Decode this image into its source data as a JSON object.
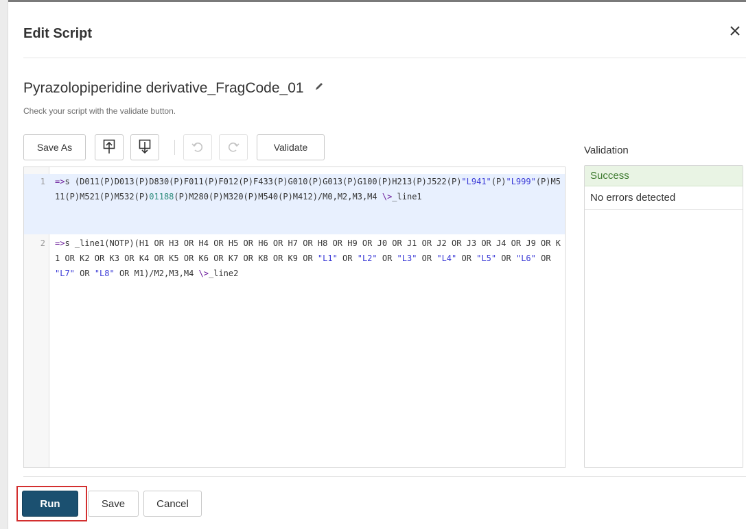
{
  "dialog": {
    "title": "Edit Script",
    "close_icon": "close-icon"
  },
  "script": {
    "name": "Pyrazolopiperidine derivative_FragCode_01",
    "edit_icon": "pencil-icon",
    "hint": "Check your script with the validate button."
  },
  "toolbar": {
    "save_as_label": "Save As",
    "upload_icon": "upload-icon",
    "download_icon": "download-icon",
    "undo_icon": "undo-icon",
    "redo_icon": "redo-icon",
    "validate_label": "Validate"
  },
  "editor": {
    "lines": [
      {
        "number": "1",
        "text": "=>s (D011(P)D013(P)D830(P)F011(P)F012(P)F433(P)G010(P)G013(P)G100(P)H213(P)J522(P)\"L941\"(P)\"L999\"(P)M511(P)M521(P)M532(P)01188(P)M280(P)M320(P)M540(P)M412)/M0,M2,M3,M4 \\>_line1"
      },
      {
        "number": "2",
        "text": "=>s _line1(NOTP)(H1 OR H3 OR H4 OR H5 OR H6 OR H7 OR H8 OR H9 OR J0 OR J1 OR J2 OR J3 OR J4 OR J9 OR K1 OR K2 OR K3 OR K4 OR K5 OR K6 OR K7 OR K8 OR K9 OR \"L1\" OR \"L2\" OR \"L3\" OR \"L4\" OR \"L5\" OR \"L6\" OR \"L7\" OR \"L8\" OR M1)/M2,M3,M4 \\>_line2"
      }
    ]
  },
  "validation": {
    "title": "Validation",
    "status": "Success",
    "message": "No errors detected",
    "status_color": "#3d7a2f"
  },
  "footer": {
    "run_label": "Run",
    "save_label": "Save",
    "cancel_label": "Cancel",
    "run_color": "#1b5070",
    "highlight_color": "#d32f2f"
  }
}
